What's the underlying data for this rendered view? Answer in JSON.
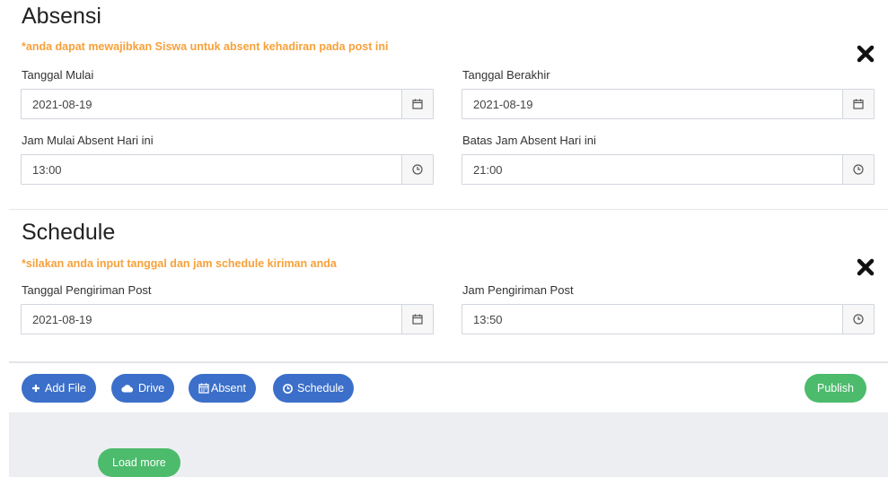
{
  "absensi": {
    "title": "Absensi",
    "note": "*anda dapat mewajibkan Siswa untuk absent kehadiran pada post ini",
    "close_icon": "close-icon",
    "start_date": {
      "label": "Tanggal Mulai",
      "value": "2021-08-19",
      "icon": "calendar-icon"
    },
    "end_date": {
      "label": "Tanggal Berakhir",
      "value": "2021-08-19",
      "icon": "calendar-icon"
    },
    "start_time": {
      "label": "Jam Mulai Absent Hari ini",
      "value": "13:00",
      "icon": "clock-icon"
    },
    "end_time": {
      "label": "Batas Jam Absent Hari ini",
      "value": "21:00",
      "icon": "clock-icon"
    }
  },
  "schedule": {
    "title": "Schedule",
    "note": "*silakan anda input tanggal dan jam schedule kiriman anda",
    "close_icon": "close-icon",
    "send_date": {
      "label": "Tanggal Pengiriman Post",
      "value": "2021-08-19",
      "icon": "calendar-icon"
    },
    "send_time": {
      "label": "Jam Pengiriman Post",
      "value": "13:50",
      "icon": "clock-icon"
    }
  },
  "toolbar": {
    "add_file": "Add File",
    "drive": "Drive",
    "absent": "Absent",
    "schedule": "Schedule",
    "publish": "Publish"
  },
  "load_more": "Load more",
  "colors": {
    "note": "#f7a13a",
    "primary_button": "#3b6fc9",
    "success_button": "#4cbb6c",
    "gray_panel": "#eceef2"
  }
}
